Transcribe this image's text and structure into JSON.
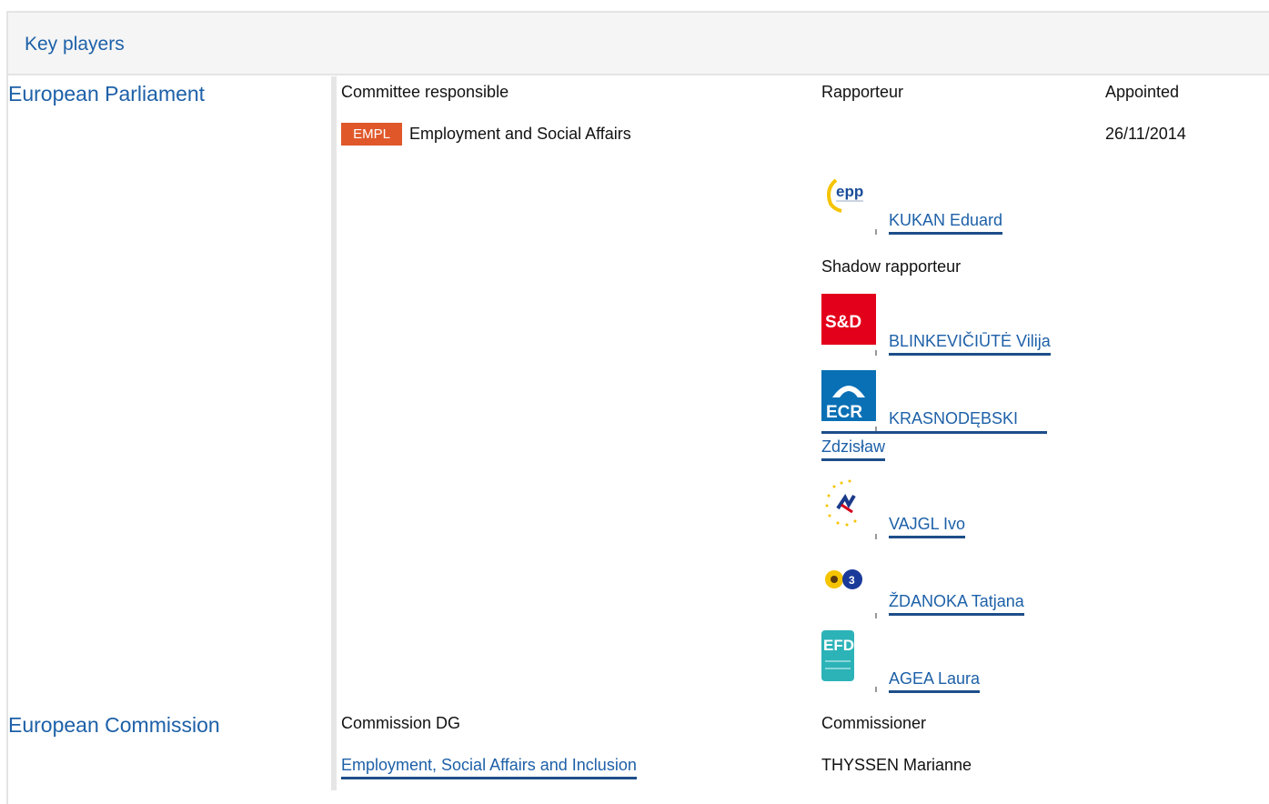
{
  "header": {
    "title": "Key players"
  },
  "parliament": {
    "label": "European Parliament",
    "col_committee": "Committee responsible",
    "col_rapporteur": "Rapporteur",
    "col_appointed": "Appointed",
    "committee_badge": "EMPL",
    "committee_name": "Employment and Social Affairs",
    "appointed_date": "26/11/2014",
    "rapporteur": {
      "name": "KUKAN Eduard",
      "group_logo": "epp-logo",
      "logo_text": "epp"
    },
    "shadow_label": "Shadow rapporteur",
    "shadows": [
      {
        "name": "BLINKEVIČIŪTĖ Vilija",
        "group_logo": "s-and-d-logo",
        "logo_text": "S&D"
      },
      {
        "name_line1": "KRASNODĘBSKI",
        "name_line2": "Zdzisław",
        "group_logo": "ecr-logo",
        "logo_text": "ECR"
      },
      {
        "name": "VAJGL Ivo",
        "group_logo": "alde-logo"
      },
      {
        "name": "ŽDANOKA Tatjana",
        "group_logo": "greens-efa-logo"
      },
      {
        "name": "AGEA Laura",
        "group_logo": "efd-logo",
        "logo_text": "EFD"
      }
    ]
  },
  "commission": {
    "label": "European Commission",
    "col_dg": "Commission DG",
    "col_commissioner": "Commissioner",
    "dg_name": "Employment, Social Affairs and Inclusion",
    "commissioner_name": "THYSSEN Marianne"
  },
  "colors": {
    "link": "#1d60a8",
    "badge": "#e0582a",
    "header_bg": "#f5f5f5"
  }
}
